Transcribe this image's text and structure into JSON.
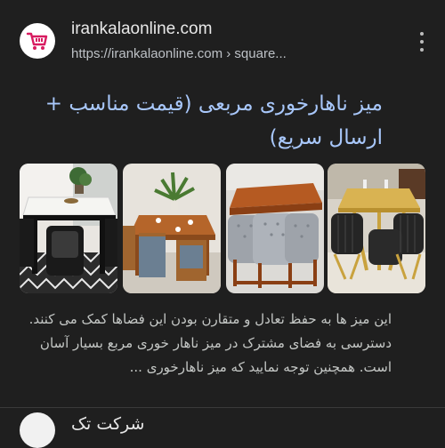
{
  "result": {
    "site_name": "irankalaonline.com",
    "url": "https://irankalaonline.com › square...",
    "title": "میز ناهارخوری مربعی (قیمت مناسب + ارسال سریع)",
    "snippet": "این میز ها به حفظ تعادل و متقارن بودن این فضاها کمک می کنند. دسترسی به فضای مشترک در میز ناهار خوری مربع بسیار آسان است. همچنین توجه نمایید که میز ناهارخوری ...",
    "favicon_icon": "shopping-cart-icon",
    "more_icon": "more-vert-icon",
    "thumbnails": [
      {
        "name": "thumbnail-1",
        "subject": "marble-dining-table"
      },
      {
        "name": "thumbnail-2",
        "subject": "wooden-square-table"
      },
      {
        "name": "thumbnail-3",
        "subject": "tufted-gray-chairs-table"
      },
      {
        "name": "thumbnail-4",
        "subject": "gold-table-black-chairs"
      }
    ]
  },
  "next_result": {
    "site_name": "شرکت تک"
  },
  "colors": {
    "background": "#1f1f1f",
    "title_link": "#a8c7fa",
    "url_text": "#bdc1c6",
    "body_text": "#c4c7c5",
    "favicon_accent": "#d81b60"
  }
}
